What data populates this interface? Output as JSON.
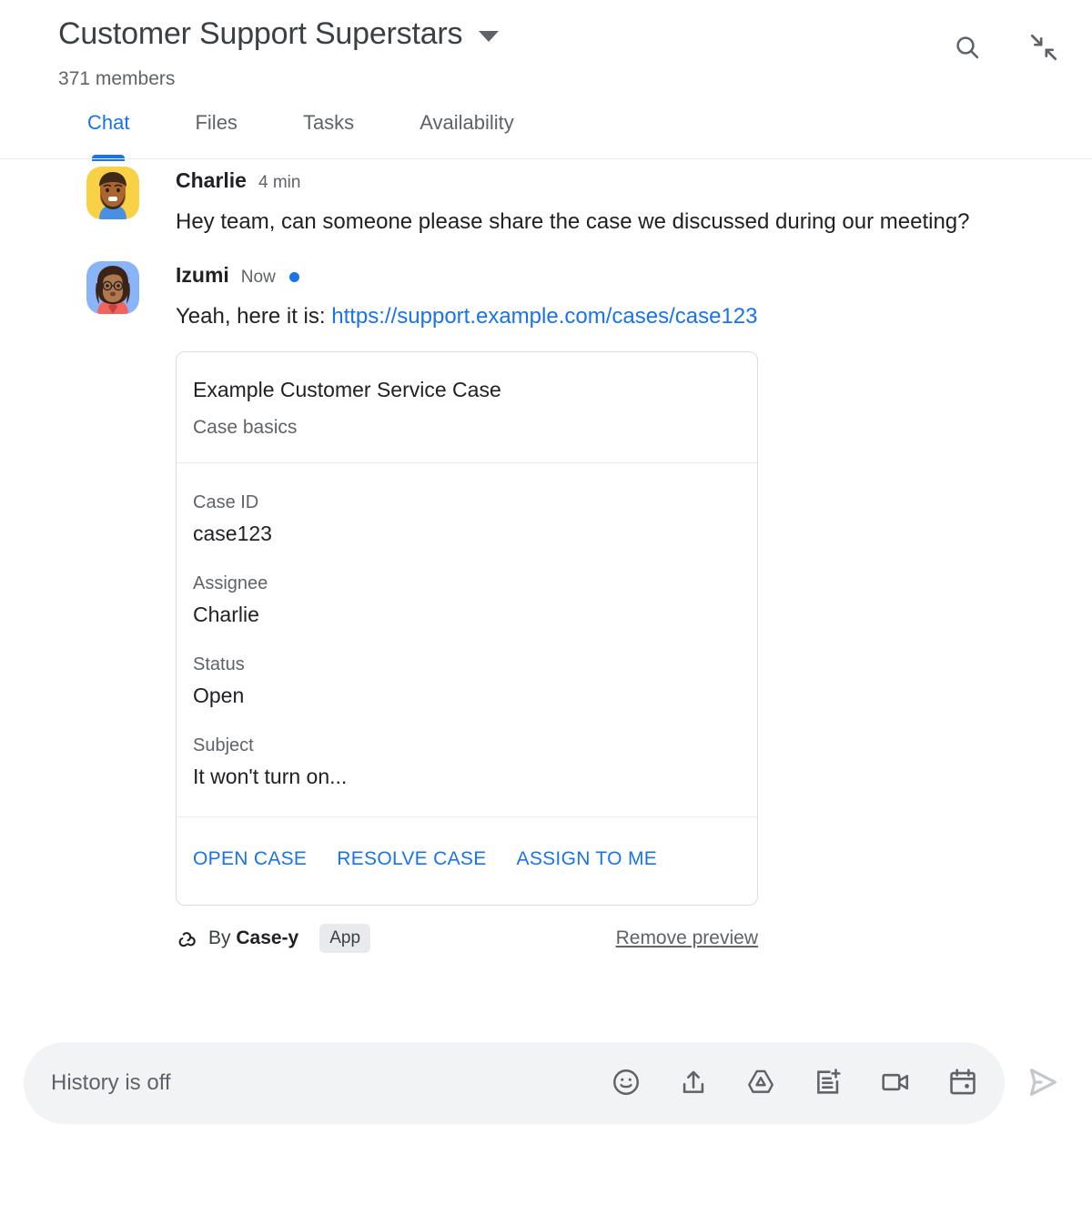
{
  "header": {
    "room_title": "Customer Support Superstars",
    "members": "371 members",
    "caret_icon": "chevron-down-icon",
    "actions": [
      {
        "name": "search-icon",
        "label": "Search"
      },
      {
        "name": "collapse-icon",
        "label": "Collapse"
      }
    ]
  },
  "tabs": [
    {
      "label": "Chat",
      "active": true
    },
    {
      "label": "Files",
      "active": false
    },
    {
      "label": "Tasks",
      "active": false
    },
    {
      "label": "Availability",
      "active": false
    }
  ],
  "messages": [
    {
      "author": "Charlie",
      "time": "4 min",
      "unread": false,
      "text": "Hey team, can someone please share the case we discussed during our meeting?"
    },
    {
      "author": "Izumi",
      "time": "Now",
      "unread": true,
      "text_prefix": "Yeah, here it is: ",
      "link": "https://support.example.com/cases/case123"
    }
  ],
  "card": {
    "title": "Example Customer Service Case",
    "subtitle": "Case basics",
    "fields": [
      {
        "label": "Case ID",
        "value": "case123"
      },
      {
        "label": "Assignee",
        "value": "Charlie"
      },
      {
        "label": "Status",
        "value": "Open"
      },
      {
        "label": "Subject",
        "value": "It won't turn on..."
      }
    ],
    "actions": [
      "OPEN CASE",
      "RESOLVE CASE",
      "ASSIGN TO ME"
    ]
  },
  "attribution": {
    "icon": "webhook-icon",
    "by_text": "By ",
    "app_name": "Case-y",
    "app_badge": "App",
    "remove_preview": "Remove preview"
  },
  "composer": {
    "placeholder": "History is off",
    "value": "",
    "icons": [
      {
        "name": "emoji-icon"
      },
      {
        "name": "upload-icon"
      },
      {
        "name": "drive-icon"
      },
      {
        "name": "add-note-icon"
      },
      {
        "name": "video-call-icon"
      },
      {
        "name": "calendar-icon"
      }
    ],
    "send": {
      "name": "send-icon"
    }
  },
  "colors": {
    "accent_blue": "#1a73e8",
    "text_primary": "#202124",
    "text_secondary": "#5f6368",
    "divider": "#e8eaed",
    "card_border": "#dadce0",
    "composer_bg": "#f1f3f4"
  }
}
